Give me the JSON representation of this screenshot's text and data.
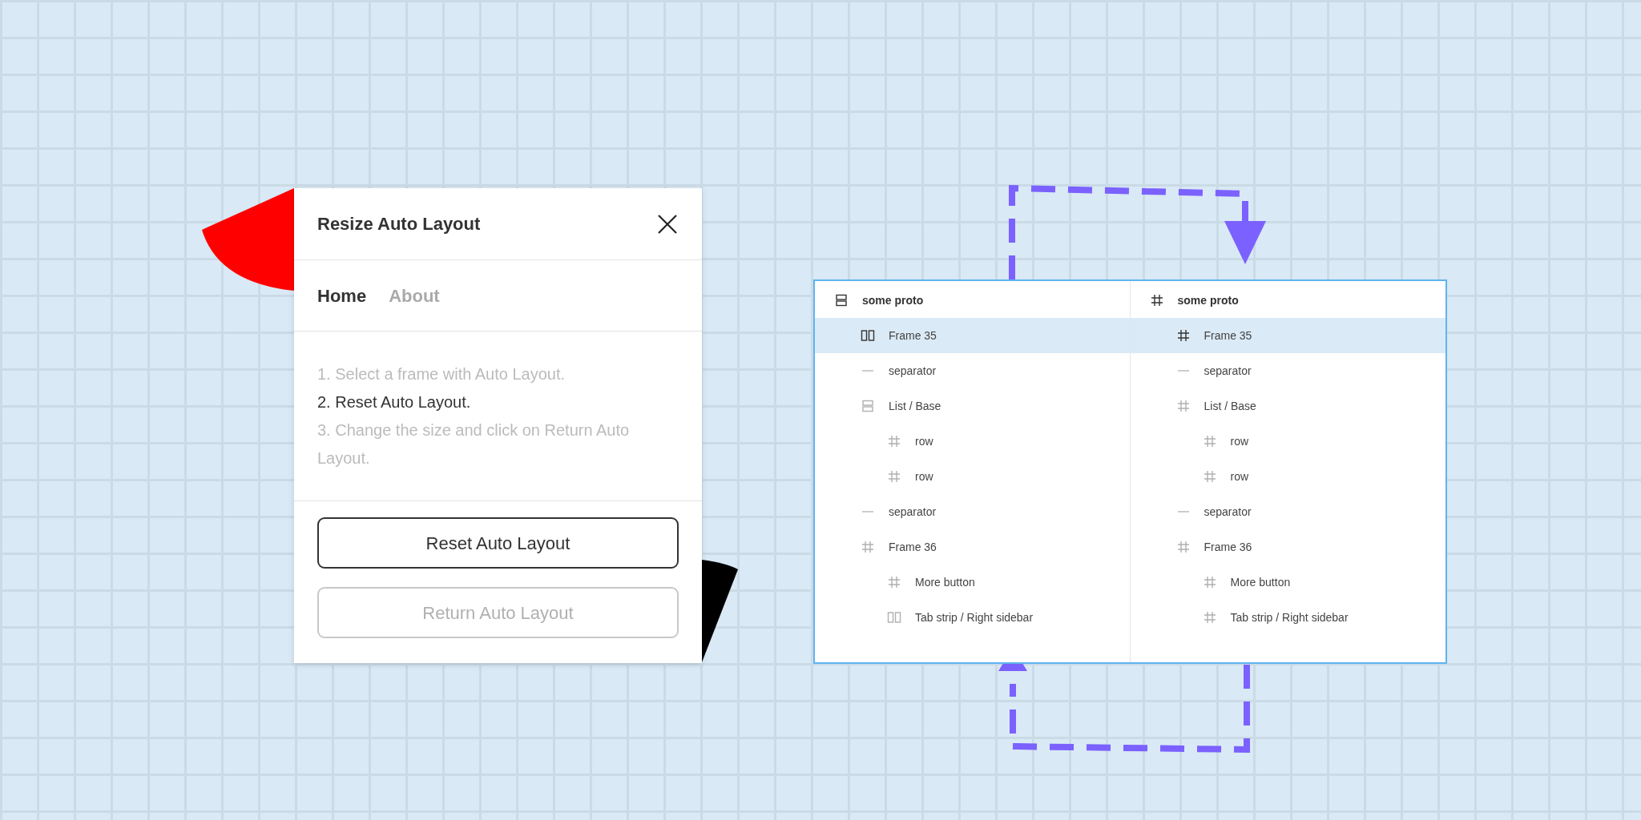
{
  "plugin": {
    "title": "Resize Auto Layout",
    "tabs": [
      {
        "label": "Home",
        "selected": true
      },
      {
        "label": "About",
        "selected": false
      }
    ],
    "steps": [
      {
        "text": "1. Select a frame with Auto Layout.",
        "active": false
      },
      {
        "text": "2. Reset Auto Layout.",
        "active": true
      },
      {
        "text": "3. Change the size and click on Return Auto Layout.",
        "active": false
      }
    ],
    "buttons": [
      {
        "label": "Reset Auto Layout",
        "disabled": false
      },
      {
        "label": "Return Auto Layout",
        "disabled": true
      }
    ]
  },
  "layer_panels": [
    {
      "name": "some proto",
      "kind": "vstack",
      "selected": false,
      "children": [
        {
          "name": "Frame 35",
          "kind": "hstack",
          "selected": true
        },
        {
          "name": "separator",
          "kind": "line",
          "selected": false
        },
        {
          "name": "List / Base",
          "kind": "vstack",
          "selected": false,
          "children": [
            {
              "name": "row",
              "kind": "frame",
              "selected": false
            },
            {
              "name": "row",
              "kind": "frame",
              "selected": false
            }
          ]
        },
        {
          "name": "separator",
          "kind": "line",
          "selected": false
        },
        {
          "name": "Frame 36",
          "kind": "frame",
          "selected": false,
          "children": [
            {
              "name": "More button",
              "kind": "frame",
              "selected": false
            },
            {
              "name": "Tab strip / Right sidebar",
              "kind": "hstack",
              "selected": false
            }
          ]
        }
      ]
    },
    {
      "name": "some proto",
      "kind": "frame",
      "selected": false,
      "children": [
        {
          "name": "Frame 35",
          "kind": "frame",
          "selected": true
        },
        {
          "name": "separator",
          "kind": "line",
          "selected": false
        },
        {
          "name": "List / Base",
          "kind": "frame",
          "selected": false,
          "children": [
            {
              "name": "row",
              "kind": "frame",
              "selected": false
            },
            {
              "name": "row",
              "kind": "frame",
              "selected": false
            }
          ]
        },
        {
          "name": "separator",
          "kind": "line",
          "selected": false
        },
        {
          "name": "Frame 36",
          "kind": "frame",
          "selected": false,
          "children": [
            {
              "name": "More button",
              "kind": "frame",
              "selected": false
            },
            {
              "name": "Tab strip / Right sidebar",
              "kind": "frame",
              "selected": false
            }
          ]
        }
      ]
    }
  ]
}
